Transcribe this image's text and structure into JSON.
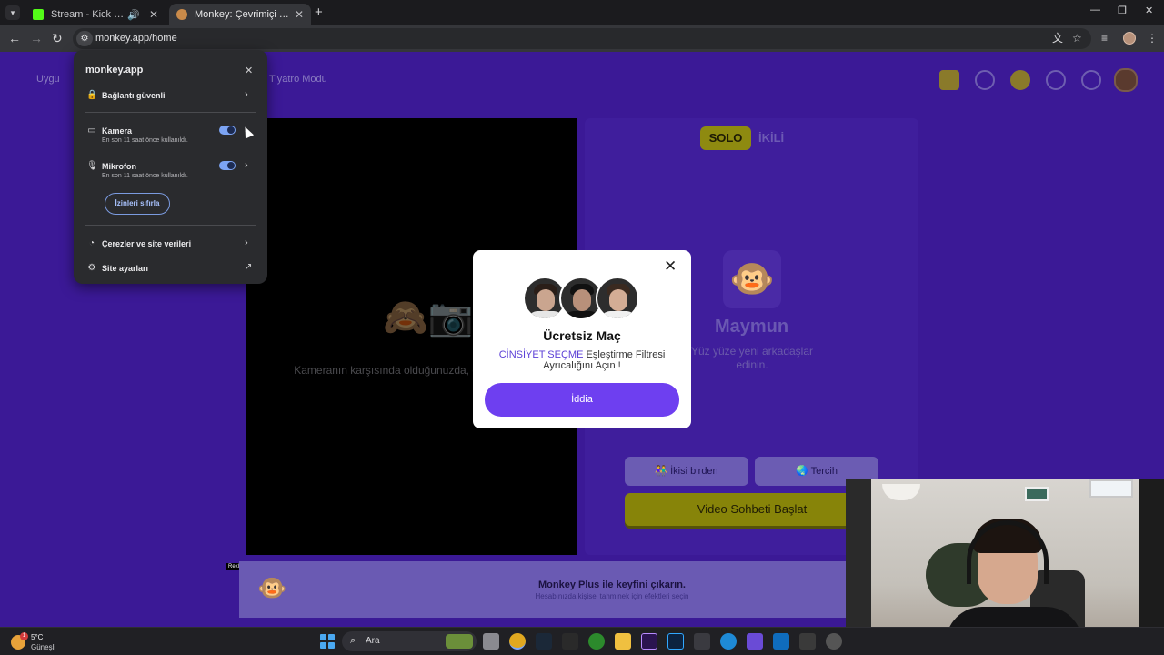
{
  "browser": {
    "tabs": [
      {
        "title": "Stream - Kick Dashboard",
        "favicon": "kick-icon",
        "audio": "speaker-icon",
        "active": false
      },
      {
        "title": "Monkey: Çevrimiçi Yeni İnsanlarla Tanışın",
        "favicon": "monkey-favicon",
        "active": true
      }
    ],
    "url": "monkey.app/home"
  },
  "site_header": {
    "links": [
      "Uygu",
      "Tiyatro Modu"
    ]
  },
  "site_info_popup": {
    "domain": "monkey.app",
    "connection": "Bağlantı güvenli",
    "permissions": [
      {
        "label": "Kamera",
        "sub": "En son 11 saat önce kullanıldı.",
        "enabled": true,
        "icon": "camera-icon"
      },
      {
        "label": "Mikrofon",
        "sub": "En son 11 saat önce kullanıldı.",
        "enabled": true,
        "icon": "microphone-icon"
      }
    ],
    "reset_label": "İzinleri sıfırla",
    "cookies": "Çerezler ve site verileri",
    "settings": "Site ayarları"
  },
  "video_area": {
    "hint": "Kameranın karşısında olduğunuzda, doğru kişiyi bulmak daha kolay olur."
  },
  "right_panel": {
    "mode_solo": "SOLO",
    "mode_duo": "İKİLİ",
    "brand": "Maymun",
    "tagline": "Yüz yüze yeni arkadaşlar edinin.",
    "filter_both": "İkisi birden",
    "filter_pref": "Tercih",
    "start_button": "Video Sohbeti Başlat"
  },
  "plus_banner": {
    "title": "Monkey Plus ile keyfini çıkarın.",
    "subtitle": "Hesabınızda kişisel tahminek için efektleri seçin",
    "ad_label": "Reklam"
  },
  "modal": {
    "title": "Ücretsiz Maç",
    "highlight": "CİNSİYET SEÇME",
    "desc": "Eşleştirme Filtresi Ayrıcalığını Açın !",
    "cta": "İddia"
  },
  "taskbar": {
    "temp": "5°C",
    "condition": "Güneşli",
    "weather_badge": "1",
    "search_placeholder": "Ara"
  },
  "colors": {
    "site_bg": "#3b1996",
    "accent_yellow": "#878409",
    "cta_purple": "#6e3ff0",
    "toggle_on": "#7ca4f4"
  }
}
